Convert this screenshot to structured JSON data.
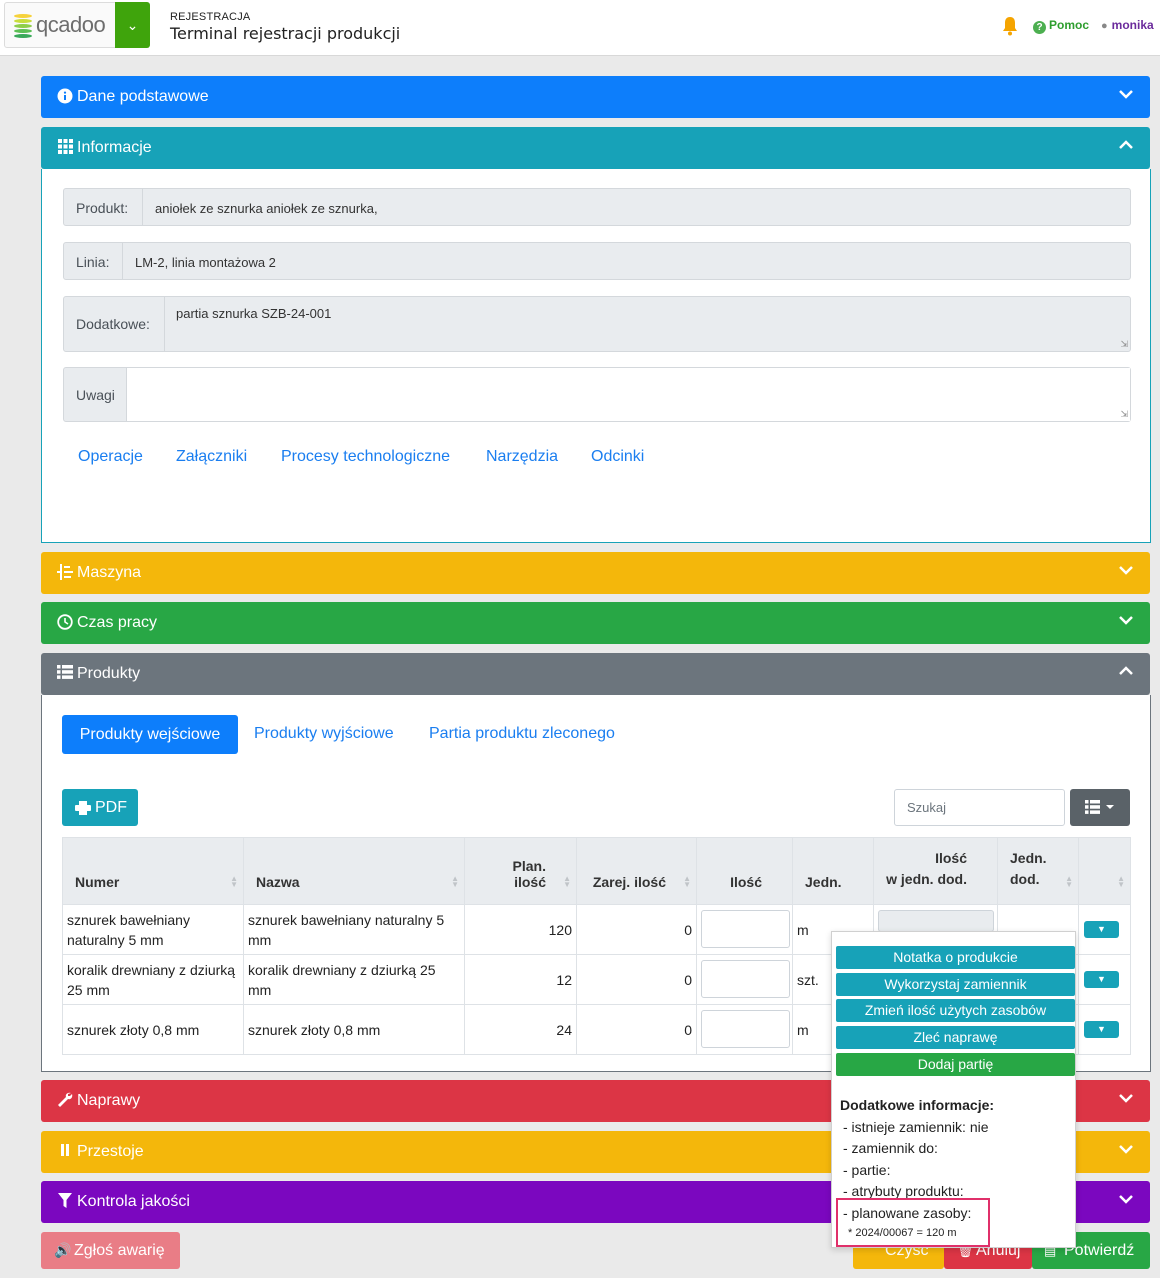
{
  "header": {
    "logo_text": "qcadoo",
    "breadcrumb_small": "REJESTRACJA",
    "title": "Terminal rejestracji produkcji",
    "help_label": "Pomoc",
    "user_label": "monika"
  },
  "panels": {
    "basic": "Dane podstawowe",
    "info": "Informacje",
    "machine": "Maszyna",
    "worktime": "Czas pracy",
    "products": "Produkty",
    "repairs": "Naprawy",
    "downtimes": "Przestoje",
    "quality": "Kontrola jakości"
  },
  "info": {
    "product_label": "Produkt:",
    "product_value": "aniołek ze sznurka aniołek ze sznurka,",
    "line_label": "Linia:",
    "line_value": "LM-2, linia montażowa 2",
    "extra_label": "Dodatkowe:",
    "extra_value": "partia sznurka SZB-24-001",
    "notes_label": "Uwagi",
    "links": [
      "Operacje",
      "Załączniki",
      "Procesy technologiczne",
      "Narzędzia",
      "Odcinki"
    ]
  },
  "products": {
    "tabs": [
      "Produkty wejściowe",
      "Produkty wyjściowe",
      "Partia produktu zleconego"
    ],
    "pdf_label": "PDF",
    "search_placeholder": "Szukaj",
    "columns": [
      "Numer",
      "Nazwa",
      "Plan. ilość",
      "Zarej. ilość",
      "Ilość",
      "Jedn.",
      "Ilość",
      "w jedn. dod.",
      "Jedn.",
      "dod."
    ],
    "rows": [
      {
        "number": "sznurek bawełniany naturalny 5 mm",
        "name": "sznurek bawełniany naturalny 5 mm",
        "planned": "120",
        "registered": "0",
        "unit": "m"
      },
      {
        "number": "koralik drewniany z dziurką 25 mm",
        "name": "koralik drewniany z dziurką 25 mm",
        "planned": "12",
        "registered": "0",
        "unit": "szt."
      },
      {
        "number": "sznurek złoty 0,8 mm",
        "name": "sznurek złoty 0,8 mm",
        "planned": "24",
        "registered": "0",
        "unit": "m"
      }
    ]
  },
  "popup": {
    "actions": [
      "Notatka o produkcie",
      "Wykorzystaj zamiennik",
      "Zmień ilość użytych zasobów",
      "Zleć naprawę",
      "Dodaj partię"
    ],
    "info_title": "Dodatkowe informacje:",
    "info_lines": [
      "- istnieje zamiennik: nie",
      "- zamiennik do:",
      "- partie:",
      "- atrybuty produktu:",
      "- planowane zasoby:"
    ],
    "resource_line": "* 2024/00067 = 120 m"
  },
  "footer": {
    "alarm_label": "Zgłoś awarię",
    "clear_label": "Czyść",
    "cancel_label": "Anuluj",
    "confirm_label": "Potwierdź"
  },
  "colors": {
    "primary": "#0d7efb",
    "info": "#17a2b8",
    "warning": "#f4b70b",
    "success": "#28a745",
    "secondary": "#6c757d",
    "danger": "#dc3545",
    "purple": "#7b07bf"
  }
}
